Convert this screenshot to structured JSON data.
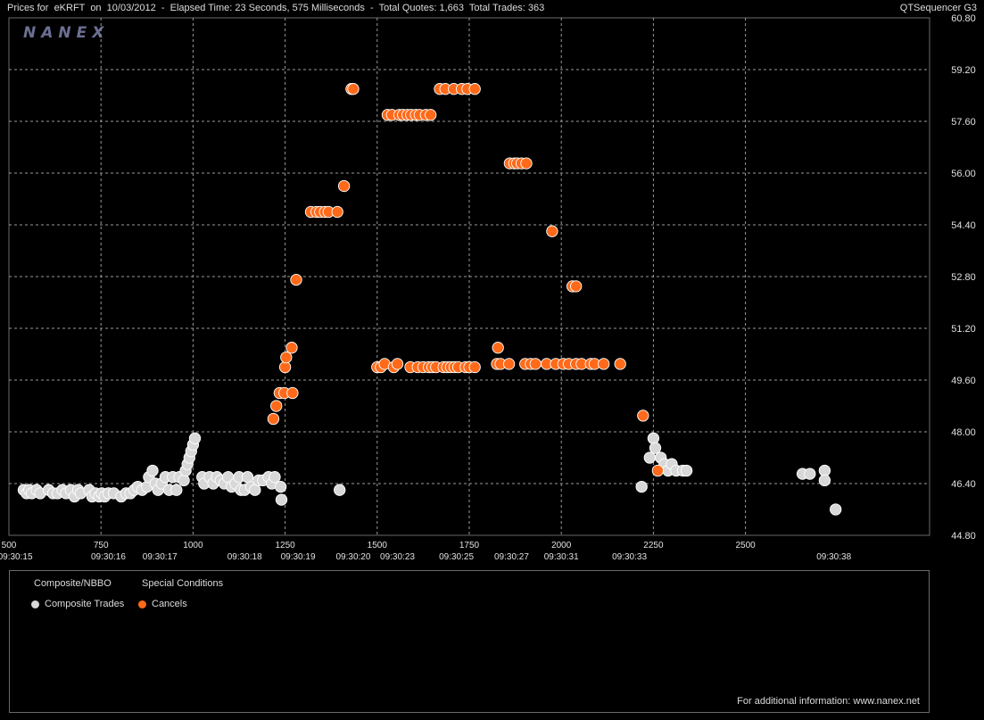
{
  "header": {
    "title": "Prices for  eKRFT  on  10/03/2012  -  Elapsed Time: 23 Seconds, 575 Milliseconds  -  Total Quotes: 1,663  Total Trades: 363",
    "app_name": "QTSequencer G3"
  },
  "watermark": "NANEX",
  "legend": {
    "heading_1": "Composite/NBBO",
    "heading_2": "Special Conditions",
    "item_trades": "Composite Trades",
    "item_cancels": "Cancels"
  },
  "footer_note": "For additional information: www.nanex.net",
  "colors": {
    "background": "#000000",
    "grid": "#9a9a9a",
    "trade": "#d8d8d8",
    "cancel": "#ff6a1a"
  },
  "chart_data": {
    "type": "scatter",
    "title": "",
    "xlabel": "",
    "ylabel": "",
    "xlim": [
      500,
      3000
    ],
    "ylim": [
      44.8,
      60.8
    ],
    "y_ticks": [
      "60.80",
      "59.20",
      "57.60",
      "56.00",
      "54.40",
      "52.80",
      "51.20",
      "49.60",
      "48.00",
      "46.40",
      "44.80"
    ],
    "x_ticks": [
      {
        "x": 500,
        "label": "500"
      },
      {
        "x": 750,
        "label": "750"
      },
      {
        "x": 1000,
        "label": "1000"
      },
      {
        "x": 1250,
        "label": "1250"
      },
      {
        "x": 1500,
        "label": "1500"
      },
      {
        "x": 1750,
        "label": "1750"
      },
      {
        "x": 2000,
        "label": "2000"
      },
      {
        "x": 2250,
        "label": "2250"
      },
      {
        "x": 2500,
        "label": "2500"
      }
    ],
    "time_labels": [
      {
        "x": 510,
        "label": "<09:30:15"
      },
      {
        "x": 770,
        "label": "09:30:16"
      },
      {
        "x": 910,
        "label": "09:30:17"
      },
      {
        "x": 1140,
        "label": "09:30:18"
      },
      {
        "x": 1285,
        "label": "09:30:19"
      },
      {
        "x": 1435,
        "label": "09:30:20"
      },
      {
        "x": 1555,
        "label": "09:30:23"
      },
      {
        "x": 1715,
        "label": "09:30:25"
      },
      {
        "x": 1865,
        "label": "09:30:27"
      },
      {
        "x": 2000,
        "label": "09:30:31"
      },
      {
        "x": 2185,
        "label": "09:30:33"
      },
      {
        "x": 2740,
        "label": "09:30:38"
      }
    ],
    "series": [
      {
        "name": "Composite Trades",
        "color": "#d8d8d8",
        "points": [
          [
            540,
            46.2
          ],
          [
            548,
            46.1
          ],
          [
            555,
            46.2
          ],
          [
            562,
            46.1
          ],
          [
            575,
            46.2
          ],
          [
            585,
            46.1
          ],
          [
            608,
            46.2
          ],
          [
            620,
            46.1
          ],
          [
            632,
            46.1
          ],
          [
            645,
            46.2
          ],
          [
            655,
            46.1
          ],
          [
            668,
            46.2
          ],
          [
            678,
            46.0
          ],
          [
            688,
            46.2
          ],
          [
            695,
            46.1
          ],
          [
            718,
            46.2
          ],
          [
            726,
            46.0
          ],
          [
            735,
            46.1
          ],
          [
            745,
            46.0
          ],
          [
            752,
            46.1
          ],
          [
            760,
            46.0
          ],
          [
            770,
            46.1
          ],
          [
            785,
            46.1
          ],
          [
            805,
            46.0
          ],
          [
            818,
            46.1
          ],
          [
            830,
            46.1
          ],
          [
            840,
            46.2
          ],
          [
            850,
            46.3
          ],
          [
            862,
            46.2
          ],
          [
            875,
            46.3
          ],
          [
            880,
            46.6
          ],
          [
            890,
            46.8
          ],
          [
            898,
            46.4
          ],
          [
            905,
            46.2
          ],
          [
            915,
            46.4
          ],
          [
            925,
            46.6
          ],
          [
            935,
            46.2
          ],
          [
            945,
            46.6
          ],
          [
            955,
            46.2
          ],
          [
            963,
            46.6
          ],
          [
            975,
            46.5
          ],
          [
            980,
            46.8
          ],
          [
            985,
            47.0
          ],
          [
            990,
            47.2
          ],
          [
            995,
            47.4
          ],
          [
            1000,
            47.6
          ],
          [
            1005,
            47.8
          ],
          [
            1025,
            46.6
          ],
          [
            1030,
            46.4
          ],
          [
            1045,
            46.6
          ],
          [
            1055,
            46.4
          ],
          [
            1065,
            46.6
          ],
          [
            1075,
            46.5
          ],
          [
            1085,
            46.4
          ],
          [
            1095,
            46.6
          ],
          [
            1105,
            46.3
          ],
          [
            1115,
            46.4
          ],
          [
            1125,
            46.6
          ],
          [
            1130,
            46.2
          ],
          [
            1140,
            46.2
          ],
          [
            1148,
            46.6
          ],
          [
            1158,
            46.3
          ],
          [
            1168,
            46.2
          ],
          [
            1178,
            46.5
          ],
          [
            1190,
            46.5
          ],
          [
            1205,
            46.6
          ],
          [
            1214,
            46.4
          ],
          [
            1222,
            46.6
          ],
          [
            1238,
            46.3
          ],
          [
            1240,
            45.9
          ],
          [
            1398,
            46.2
          ],
          [
            2218,
            46.3
          ],
          [
            2240,
            47.2
          ],
          [
            2250,
            47.8
          ],
          [
            2255,
            47.5
          ],
          [
            2270,
            47.2
          ],
          [
            2280,
            47.0
          ],
          [
            2290,
            46.8
          ],
          [
            2300,
            47.0
          ],
          [
            2312,
            46.8
          ],
          [
            2330,
            46.8
          ],
          [
            2340,
            46.8
          ],
          [
            2655,
            46.7
          ],
          [
            2675,
            46.7
          ],
          [
            2715,
            46.8
          ],
          [
            2715,
            46.5
          ],
          [
            2745,
            45.6
          ]
        ]
      },
      {
        "name": "Cancels",
        "color": "#ff6a1a",
        "points": [
          [
            1218,
            48.4
          ],
          [
            1226,
            48.8
          ],
          [
            1235,
            49.2
          ],
          [
            1248,
            49.2
          ],
          [
            1250,
            50.0
          ],
          [
            1253,
            50.3
          ],
          [
            1270,
            49.2
          ],
          [
            1268,
            50.6
          ],
          [
            1280,
            52.7
          ],
          [
            1320,
            54.8
          ],
          [
            1335,
            54.8
          ],
          [
            1345,
            54.8
          ],
          [
            1358,
            54.8
          ],
          [
            1368,
            54.8
          ],
          [
            1392,
            54.8
          ],
          [
            1410,
            55.6
          ],
          [
            1430,
            58.6
          ],
          [
            1435,
            58.6
          ],
          [
            1500,
            50.0
          ],
          [
            1510,
            50.0
          ],
          [
            1520,
            50.1
          ],
          [
            1528,
            57.8
          ],
          [
            1540,
            57.8
          ],
          [
            1545,
            50.0
          ],
          [
            1555,
            50.1
          ],
          [
            1560,
            57.8
          ],
          [
            1570,
            57.8
          ],
          [
            1582,
            57.8
          ],
          [
            1590,
            50.0
          ],
          [
            1592,
            57.8
          ],
          [
            1605,
            57.8
          ],
          [
            1610,
            50.0
          ],
          [
            1615,
            57.8
          ],
          [
            1625,
            50.0
          ],
          [
            1632,
            57.8
          ],
          [
            1640,
            50.0
          ],
          [
            1645,
            57.8
          ],
          [
            1650,
            50.0
          ],
          [
            1660,
            50.0
          ],
          [
            1670,
            58.6
          ],
          [
            1680,
            50.0
          ],
          [
            1685,
            58.6
          ],
          [
            1690,
            50.0
          ],
          [
            1700,
            50.0
          ],
          [
            1708,
            58.6
          ],
          [
            1710,
            50.0
          ],
          [
            1720,
            50.0
          ],
          [
            1730,
            58.6
          ],
          [
            1740,
            50.0
          ],
          [
            1745,
            58.6
          ],
          [
            1750,
            50.0
          ],
          [
            1765,
            58.6
          ],
          [
            1765,
            50.0
          ],
          [
            1825,
            50.1
          ],
          [
            1828,
            50.6
          ],
          [
            1835,
            50.1
          ],
          [
            1858,
            50.1
          ],
          [
            1860,
            56.3
          ],
          [
            1872,
            56.3
          ],
          [
            1880,
            56.3
          ],
          [
            1892,
            56.3
          ],
          [
            1902,
            50.1
          ],
          [
            1905,
            56.3
          ],
          [
            1917,
            50.1
          ],
          [
            1930,
            50.1
          ],
          [
            1960,
            50.1
          ],
          [
            1975,
            54.2
          ],
          [
            1985,
            50.1
          ],
          [
            2005,
            50.1
          ],
          [
            2020,
            50.1
          ],
          [
            2030,
            52.5
          ],
          [
            2040,
            52.5
          ],
          [
            2040,
            50.1
          ],
          [
            2055,
            50.1
          ],
          [
            2080,
            50.1
          ],
          [
            2090,
            50.1
          ],
          [
            2115,
            50.1
          ],
          [
            2160,
            50.1
          ],
          [
            2222,
            48.5
          ],
          [
            2262,
            46.8
          ]
        ]
      }
    ]
  }
}
